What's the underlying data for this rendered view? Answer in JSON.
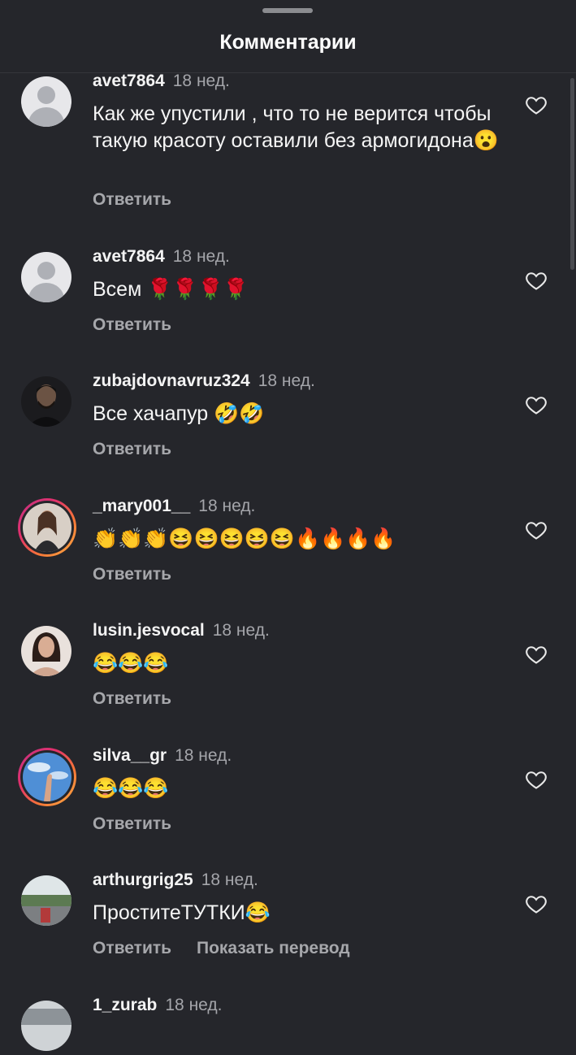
{
  "header": {
    "title": "Комментарии"
  },
  "comments": [
    {
      "username": "avet7864",
      "time": "18 нед.",
      "text": "Как же упустили , что то не верится чтобы такую красоту оставили без армогидона😮",
      "reply": "Ответить"
    },
    {
      "username": "avet7864",
      "time": "18 нед.",
      "text": "Всем 🌹🌹🌹🌹",
      "reply": "Ответить"
    },
    {
      "username": "zubajdovnavruz324",
      "time": "18 нед.",
      "text": "Все  хачапур 🤣🤣",
      "reply": "Ответить"
    },
    {
      "username": "_mary001__",
      "time": "18 нед.",
      "text": "👏👏👏😆😆😆😆😆🔥🔥🔥🔥",
      "reply": "Ответить"
    },
    {
      "username": "lusin.jesvocal",
      "time": "18 нед.",
      "text": "😂😂😂",
      "reply": "Ответить"
    },
    {
      "username": "silva__gr",
      "time": "18 нед.",
      "text": "😂😂😂",
      "reply": "Ответить"
    },
    {
      "username": "arthurgrig25",
      "time": "18 нед.",
      "text": "ПроститеТУТКИ😂",
      "reply": "Ответить",
      "translate": "Показать перевод"
    },
    {
      "username": "1_zurab",
      "time": "18 нед."
    }
  ],
  "icons": {
    "like": "heart-outline-icon",
    "default_avatar": "default-avatar-icon"
  },
  "colors": {
    "background": "#25262b",
    "muted": "#a6a7ab",
    "story_ring": "#e1306c"
  }
}
